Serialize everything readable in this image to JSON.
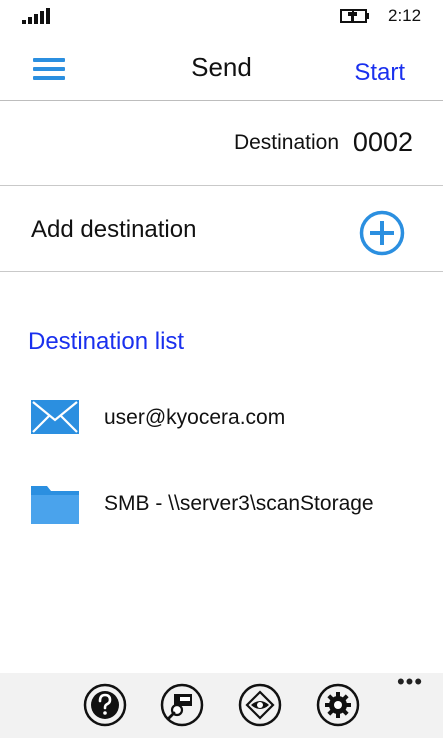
{
  "status_bar": {
    "time": "2:12",
    "signal_icon": "signal-strength-icon",
    "battery_icon": "battery-charging-icon"
  },
  "header": {
    "menu_icon": "hamburger-menu-icon",
    "title": "Send",
    "start_label": "Start"
  },
  "destination": {
    "label": "Destination",
    "value": "0002"
  },
  "add_destination": {
    "label": "Add destination",
    "icon": "add-circle-icon"
  },
  "destination_list": {
    "heading": "Destination list",
    "items": [
      {
        "icon": "envelope-icon",
        "label": "user@kyocera.com"
      },
      {
        "icon": "folder-icon",
        "label": "SMB - \\\\server3\\scanStorage"
      }
    ]
  },
  "appbar": {
    "buttons": [
      {
        "icon": "help-icon"
      },
      {
        "icon": "printer-search-icon"
      },
      {
        "icon": "preview-eye-icon"
      },
      {
        "icon": "settings-gear-icon"
      }
    ],
    "more_label": "•••"
  },
  "colors": {
    "accent_blue": "#1a30ee",
    "icon_blue": "#2b8fe0",
    "appbar_bg": "#f2f2f2"
  }
}
